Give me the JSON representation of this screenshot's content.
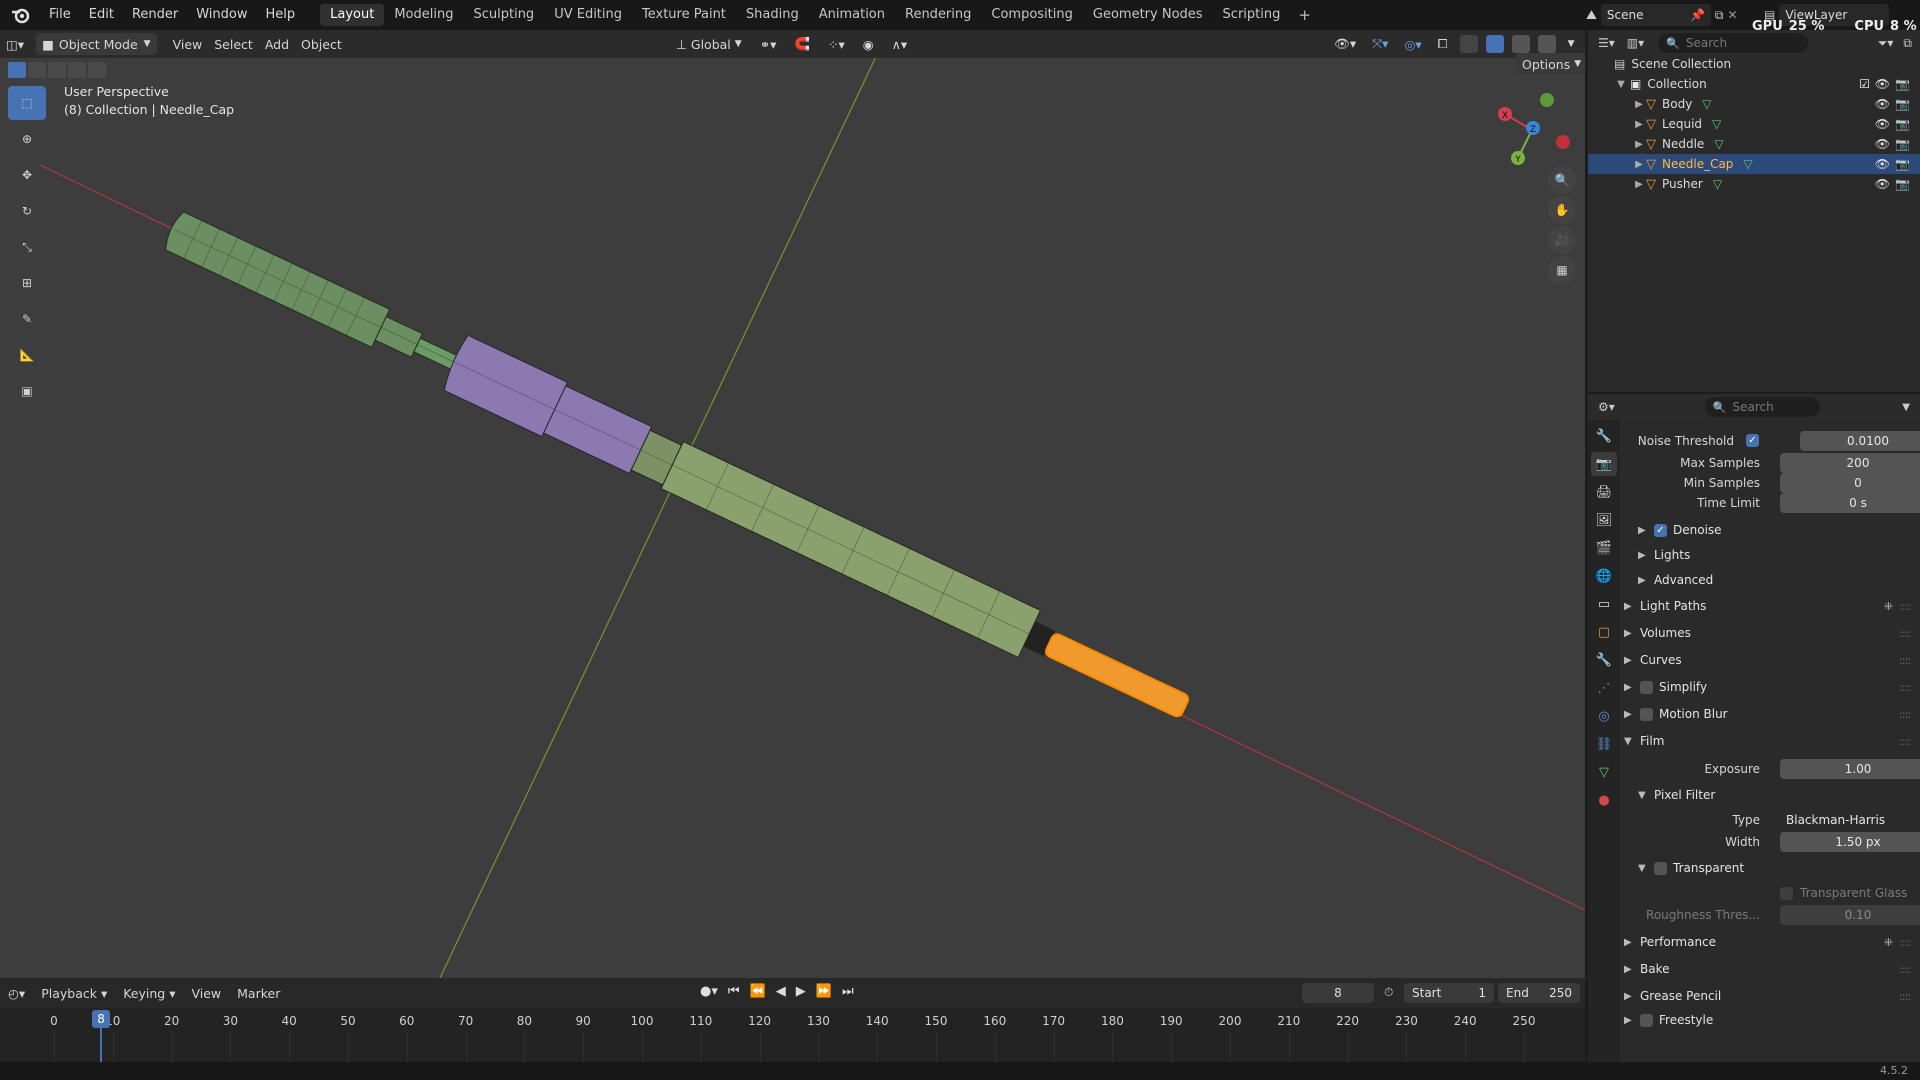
{
  "topbar": {
    "menus": [
      "File",
      "Edit",
      "Render",
      "Window",
      "Help"
    ],
    "workspaces": [
      "Layout",
      "Modeling",
      "Sculpting",
      "UV Editing",
      "Texture Paint",
      "Shading",
      "Animation",
      "Rendering",
      "Compositing",
      "Geometry Nodes",
      "Scripting"
    ],
    "active_workspace": "Layout",
    "scene": "Scene",
    "view_layer": "ViewLayer",
    "gpu_label": "GPU",
    "gpu_value": "25 %",
    "cpu_label": "CPU",
    "cpu_value": "8 %"
  },
  "viewport": {
    "mode": "Object Mode",
    "menus": [
      "View",
      "Select",
      "Add",
      "Object"
    ],
    "orientation": "Global",
    "options_label": "Options",
    "perspective_label": "User Perspective",
    "collection_label": "(8) Collection | Needle_Cap",
    "gizmo_axes": [
      "X",
      "Y",
      "Z"
    ]
  },
  "outliner": {
    "search_placeholder": "Search",
    "scene_collection": "Scene Collection",
    "collection": "Collection",
    "objects": [
      {
        "name": "Body",
        "selected": false
      },
      {
        "name": "Lequid",
        "selected": false
      },
      {
        "name": "Neddle",
        "selected": false
      },
      {
        "name": "Needle_Cap",
        "selected": true
      },
      {
        "name": "Pusher",
        "selected": false
      }
    ]
  },
  "properties": {
    "search_placeholder": "Search",
    "noise_threshold_label": "Noise Threshold",
    "noise_threshold_value": "0.0100",
    "max_samples_label": "Max Samples",
    "max_samples_value": "200",
    "min_samples_label": "Min Samples",
    "min_samples_value": "0",
    "time_limit_label": "Time Limit",
    "time_limit_value": "0 s",
    "denoise": "Denoise",
    "lights": "Lights",
    "advanced": "Advanced",
    "light_paths": "Light Paths",
    "volumes": "Volumes",
    "curves": "Curves",
    "simplify": "Simplify",
    "motion_blur": "Motion Blur",
    "film": "Film",
    "exposure_label": "Exposure",
    "exposure_value": "1.00",
    "pixel_filter": "Pixel Filter",
    "type_label": "Type",
    "type_value": "Blackman-Harris",
    "width_label": "Width",
    "width_value": "1.50 px",
    "transparent": "Transparent",
    "transparent_glass": "Transparent Glass",
    "roughness_label": "Roughness Thres...",
    "roughness_value": "0.10",
    "performance": "Performance",
    "bake": "Bake",
    "grease_pencil": "Grease Pencil",
    "freestyle": "Freestyle"
  },
  "timeline": {
    "menus": [
      "Playback",
      "Keying",
      "View",
      "Marker"
    ],
    "current_frame": "8",
    "start_label": "Start",
    "start_value": "1",
    "end_label": "End",
    "end_value": "250",
    "ticks": [
      "0",
      "10",
      "20",
      "30",
      "40",
      "50",
      "60",
      "70",
      "80",
      "90",
      "100",
      "110",
      "120",
      "130",
      "140",
      "150",
      "160",
      "170",
      "180",
      "190",
      "200",
      "210",
      "220",
      "230",
      "240",
      "250"
    ]
  },
  "statusbar": {
    "version": "4.5.2"
  },
  "colors": {
    "accent": "#4772b3",
    "selected_object": "#ff9a1a",
    "x_axis": "#d23f4f",
    "y_axis": "#7db33c",
    "z_axis": "#3d85d9"
  }
}
